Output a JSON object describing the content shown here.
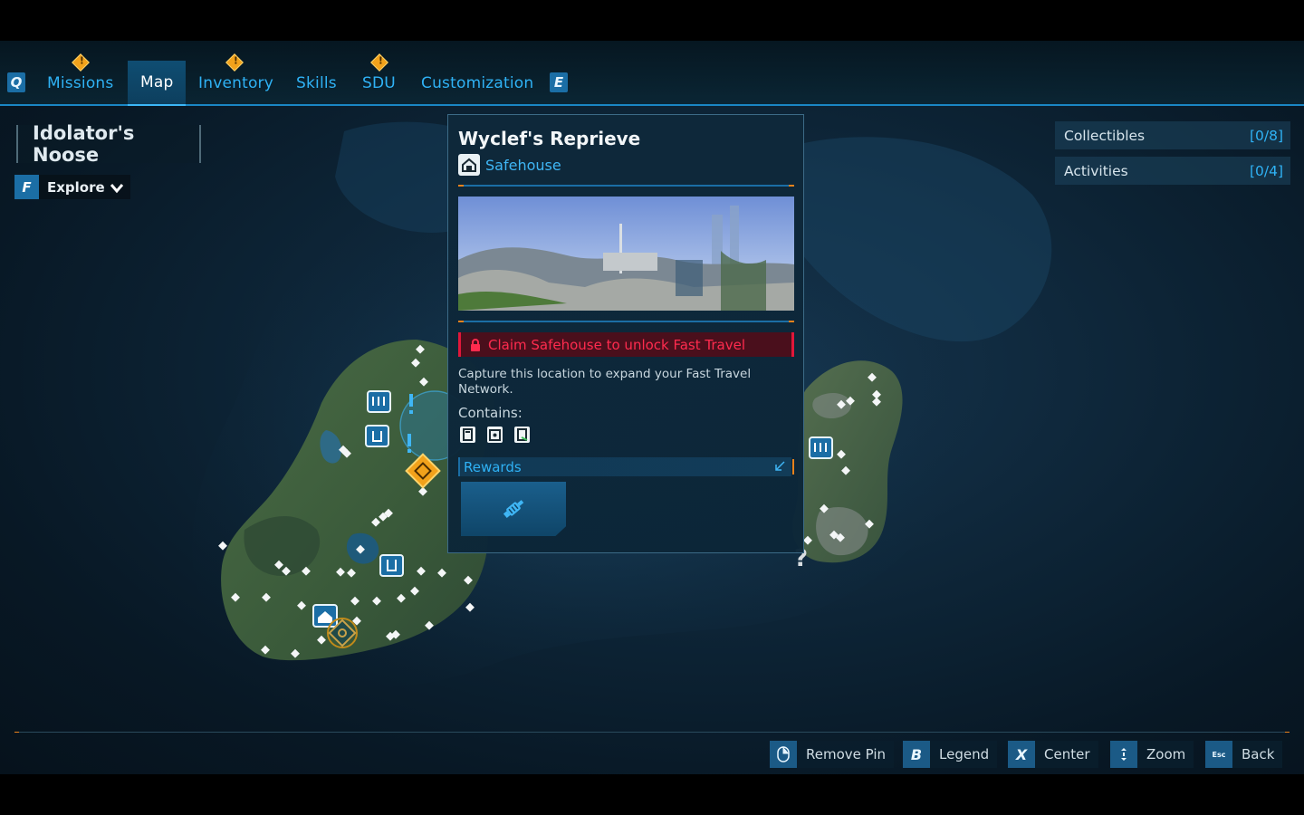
{
  "nav": {
    "left_key": "Q",
    "right_key": "E",
    "tabs": [
      {
        "label": "Missions",
        "alert": true,
        "active": false
      },
      {
        "label": "Map",
        "alert": false,
        "active": true
      },
      {
        "label": "Inventory",
        "alert": true,
        "active": false
      },
      {
        "label": "Skills",
        "alert": false,
        "active": false
      },
      {
        "label": "SDU",
        "alert": true,
        "active": false
      },
      {
        "label": "Customization",
        "alert": false,
        "active": false
      }
    ],
    "alert_glyph": "!"
  },
  "location": {
    "name": "Idolator's Noose",
    "mode_key": "F",
    "mode_label": "Explore"
  },
  "tracker": {
    "collectibles_label": "Collectibles",
    "collectibles_count": "[0/8]",
    "activities_label": "Activities",
    "activities_count": "[0/4]"
  },
  "popup": {
    "title": "Wyclef's Reprieve",
    "type_label": "Safehouse",
    "type_icon": "safehouse-icon",
    "claim_text": "Claim Safehouse to unlock Fast Travel",
    "description": "Capture this location to expand your Fast Travel Network.",
    "contains_label": "Contains:",
    "contains_icons": [
      "ammo-dispenser-icon",
      "quick-change-icon",
      "health-station-icon"
    ],
    "rewards_label": "Rewards",
    "reward_icon": "syringe-icon"
  },
  "map_markers": {
    "unknown_glyph": "?",
    "exclaim_glyph": "!"
  },
  "hints": [
    {
      "key": "",
      "key_icon": "mouse-right-icon",
      "label": "Remove Pin"
    },
    {
      "key": "B",
      "key_icon": "",
      "label": "Legend"
    },
    {
      "key": "X",
      "key_icon": "",
      "label": "Center"
    },
    {
      "key": "",
      "key_icon": "mouse-wheel-icon",
      "label": "Zoom"
    },
    {
      "key": "Esc",
      "key_icon": "",
      "label": "Back"
    }
  ],
  "colors": {
    "accent_blue": "#2fb2f5",
    "alert_orange": "#f2a21b",
    "lock_red": "#ff2b4e"
  }
}
